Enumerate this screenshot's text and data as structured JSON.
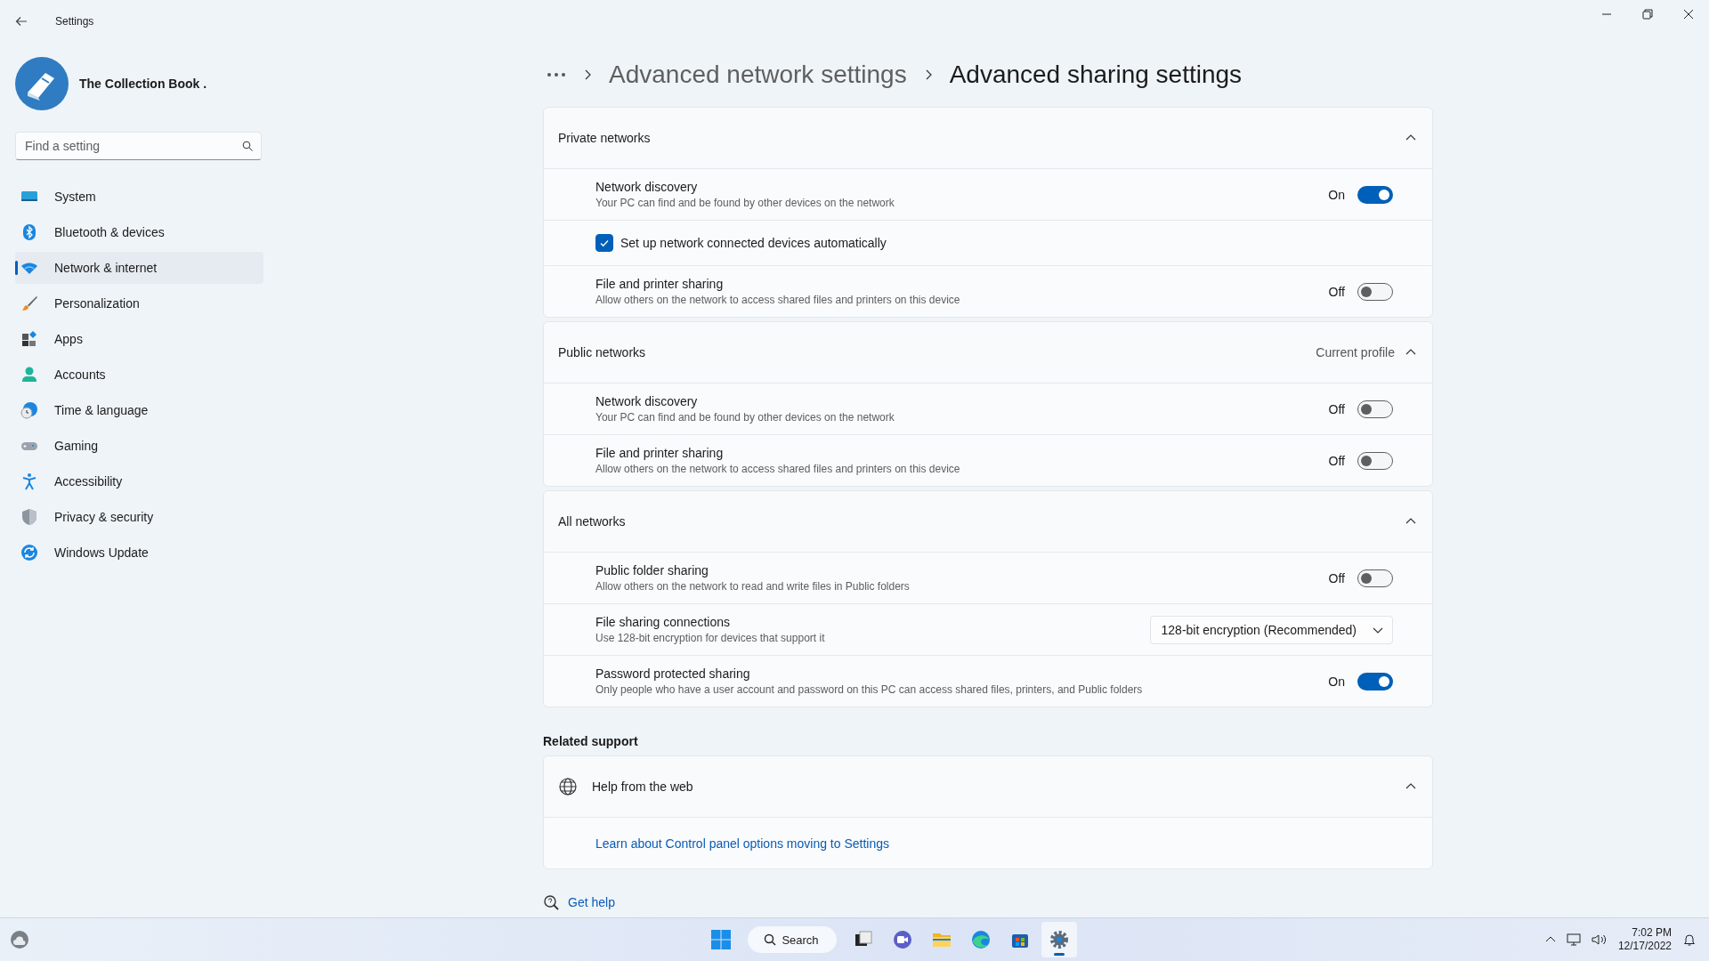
{
  "window": {
    "title": "Settings"
  },
  "profile": {
    "name": "The Collection Book ."
  },
  "search": {
    "placeholder": "Find a setting"
  },
  "nav": [
    {
      "label": "System",
      "selected": false
    },
    {
      "label": "Bluetooth & devices",
      "selected": false
    },
    {
      "label": "Network & internet",
      "selected": true
    },
    {
      "label": "Personalization",
      "selected": false
    },
    {
      "label": "Apps",
      "selected": false
    },
    {
      "label": "Accounts",
      "selected": false
    },
    {
      "label": "Time & language",
      "selected": false
    },
    {
      "label": "Gaming",
      "selected": false
    },
    {
      "label": "Accessibility",
      "selected": false
    },
    {
      "label": "Privacy & security",
      "selected": false
    },
    {
      "label": "Windows Update",
      "selected": false
    }
  ],
  "breadcrumb": [
    {
      "label": "Advanced network settings",
      "current": false
    },
    {
      "label": "Advanced sharing settings",
      "current": true
    }
  ],
  "sections": [
    {
      "title": "Private networks",
      "expanded": true,
      "rows": [
        {
          "kind": "toggle",
          "title": "Network discovery",
          "description": "Your PC can find and be found by other devices on the network",
          "state_label": "On",
          "on": true
        },
        {
          "kind": "checkbox",
          "title": "Set up network connected devices automatically",
          "checked": true
        },
        {
          "kind": "toggle",
          "title": "File and printer sharing",
          "description": "Allow others on the network to access shared files and printers on this device",
          "state_label": "Off",
          "on": false
        }
      ]
    },
    {
      "title": "Public networks",
      "note": "Current profile",
      "expanded": true,
      "rows": [
        {
          "kind": "toggle",
          "title": "Network discovery",
          "description": "Your PC can find and be found by other devices on the network",
          "state_label": "Off",
          "on": false
        },
        {
          "kind": "toggle",
          "title": "File and printer sharing",
          "description": "Allow others on the network to access shared files and printers on this device",
          "state_label": "Off",
          "on": false
        }
      ]
    },
    {
      "title": "All networks",
      "expanded": true,
      "rows": [
        {
          "kind": "toggle",
          "title": "Public folder sharing",
          "description": "Allow others on the network to read and write files in Public folders",
          "state_label": "Off",
          "on": false
        },
        {
          "kind": "dropdown",
          "title": "File sharing connections",
          "description": "Use 128-bit encryption for devices that support it",
          "value": "128-bit encryption (Recommended)"
        },
        {
          "kind": "toggle",
          "title": "Password protected sharing",
          "description": "Only people who have a user account and password on this PC can access shared files, printers, and Public folders",
          "state_label": "On",
          "on": true
        }
      ]
    }
  ],
  "related_support": {
    "heading": "Related support",
    "title": "Help from the web",
    "expanded": true,
    "links": [
      "Learn about Control panel options moving to Settings"
    ]
  },
  "get_help": "Get help",
  "taskbar": {
    "search": "Search",
    "apps": [
      {
        "selected": false
      },
      {
        "selected": false
      },
      {
        "selected": false
      },
      {
        "selected": false
      },
      {
        "selected": false
      },
      {
        "selected": true
      }
    ],
    "time": "7:02 PM",
    "date": "12/17/2022"
  }
}
